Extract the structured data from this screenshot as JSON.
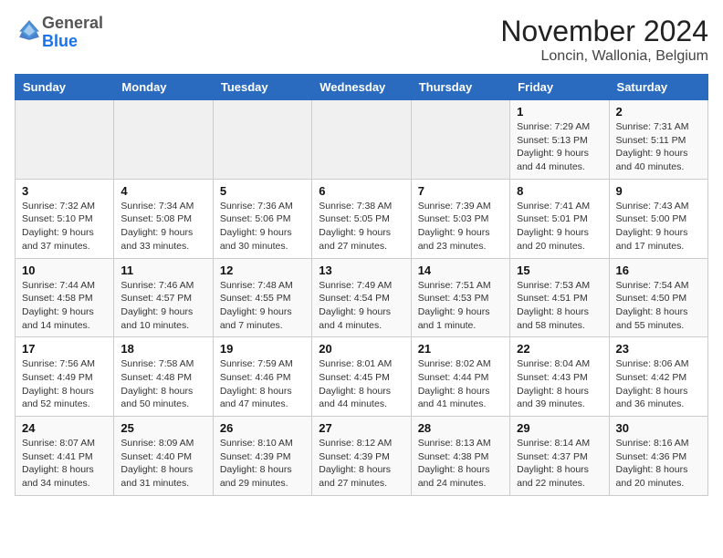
{
  "logo": {
    "general": "General",
    "blue": "Blue"
  },
  "header": {
    "month": "November 2024",
    "location": "Loncin, Wallonia, Belgium"
  },
  "days_of_week": [
    "Sunday",
    "Monday",
    "Tuesday",
    "Wednesday",
    "Thursday",
    "Friday",
    "Saturday"
  ],
  "weeks": [
    [
      {
        "day": "",
        "sunrise": "",
        "sunset": "",
        "daylight": ""
      },
      {
        "day": "",
        "sunrise": "",
        "sunset": "",
        "daylight": ""
      },
      {
        "day": "",
        "sunrise": "",
        "sunset": "",
        "daylight": ""
      },
      {
        "day": "",
        "sunrise": "",
        "sunset": "",
        "daylight": ""
      },
      {
        "day": "",
        "sunrise": "",
        "sunset": "",
        "daylight": ""
      },
      {
        "day": "1",
        "sunrise": "Sunrise: 7:29 AM",
        "sunset": "Sunset: 5:13 PM",
        "daylight": "Daylight: 9 hours and 44 minutes."
      },
      {
        "day": "2",
        "sunrise": "Sunrise: 7:31 AM",
        "sunset": "Sunset: 5:11 PM",
        "daylight": "Daylight: 9 hours and 40 minutes."
      }
    ],
    [
      {
        "day": "3",
        "sunrise": "Sunrise: 7:32 AM",
        "sunset": "Sunset: 5:10 PM",
        "daylight": "Daylight: 9 hours and 37 minutes."
      },
      {
        "day": "4",
        "sunrise": "Sunrise: 7:34 AM",
        "sunset": "Sunset: 5:08 PM",
        "daylight": "Daylight: 9 hours and 33 minutes."
      },
      {
        "day": "5",
        "sunrise": "Sunrise: 7:36 AM",
        "sunset": "Sunset: 5:06 PM",
        "daylight": "Daylight: 9 hours and 30 minutes."
      },
      {
        "day": "6",
        "sunrise": "Sunrise: 7:38 AM",
        "sunset": "Sunset: 5:05 PM",
        "daylight": "Daylight: 9 hours and 27 minutes."
      },
      {
        "day": "7",
        "sunrise": "Sunrise: 7:39 AM",
        "sunset": "Sunset: 5:03 PM",
        "daylight": "Daylight: 9 hours and 23 minutes."
      },
      {
        "day": "8",
        "sunrise": "Sunrise: 7:41 AM",
        "sunset": "Sunset: 5:01 PM",
        "daylight": "Daylight: 9 hours and 20 minutes."
      },
      {
        "day": "9",
        "sunrise": "Sunrise: 7:43 AM",
        "sunset": "Sunset: 5:00 PM",
        "daylight": "Daylight: 9 hours and 17 minutes."
      }
    ],
    [
      {
        "day": "10",
        "sunrise": "Sunrise: 7:44 AM",
        "sunset": "Sunset: 4:58 PM",
        "daylight": "Daylight: 9 hours and 14 minutes."
      },
      {
        "day": "11",
        "sunrise": "Sunrise: 7:46 AM",
        "sunset": "Sunset: 4:57 PM",
        "daylight": "Daylight: 9 hours and 10 minutes."
      },
      {
        "day": "12",
        "sunrise": "Sunrise: 7:48 AM",
        "sunset": "Sunset: 4:55 PM",
        "daylight": "Daylight: 9 hours and 7 minutes."
      },
      {
        "day": "13",
        "sunrise": "Sunrise: 7:49 AM",
        "sunset": "Sunset: 4:54 PM",
        "daylight": "Daylight: 9 hours and 4 minutes."
      },
      {
        "day": "14",
        "sunrise": "Sunrise: 7:51 AM",
        "sunset": "Sunset: 4:53 PM",
        "daylight": "Daylight: 9 hours and 1 minute."
      },
      {
        "day": "15",
        "sunrise": "Sunrise: 7:53 AM",
        "sunset": "Sunset: 4:51 PM",
        "daylight": "Daylight: 8 hours and 58 minutes."
      },
      {
        "day": "16",
        "sunrise": "Sunrise: 7:54 AM",
        "sunset": "Sunset: 4:50 PM",
        "daylight": "Daylight: 8 hours and 55 minutes."
      }
    ],
    [
      {
        "day": "17",
        "sunrise": "Sunrise: 7:56 AM",
        "sunset": "Sunset: 4:49 PM",
        "daylight": "Daylight: 8 hours and 52 minutes."
      },
      {
        "day": "18",
        "sunrise": "Sunrise: 7:58 AM",
        "sunset": "Sunset: 4:48 PM",
        "daylight": "Daylight: 8 hours and 50 minutes."
      },
      {
        "day": "19",
        "sunrise": "Sunrise: 7:59 AM",
        "sunset": "Sunset: 4:46 PM",
        "daylight": "Daylight: 8 hours and 47 minutes."
      },
      {
        "day": "20",
        "sunrise": "Sunrise: 8:01 AM",
        "sunset": "Sunset: 4:45 PM",
        "daylight": "Daylight: 8 hours and 44 minutes."
      },
      {
        "day": "21",
        "sunrise": "Sunrise: 8:02 AM",
        "sunset": "Sunset: 4:44 PM",
        "daylight": "Daylight: 8 hours and 41 minutes."
      },
      {
        "day": "22",
        "sunrise": "Sunrise: 8:04 AM",
        "sunset": "Sunset: 4:43 PM",
        "daylight": "Daylight: 8 hours and 39 minutes."
      },
      {
        "day": "23",
        "sunrise": "Sunrise: 8:06 AM",
        "sunset": "Sunset: 4:42 PM",
        "daylight": "Daylight: 8 hours and 36 minutes."
      }
    ],
    [
      {
        "day": "24",
        "sunrise": "Sunrise: 8:07 AM",
        "sunset": "Sunset: 4:41 PM",
        "daylight": "Daylight: 8 hours and 34 minutes."
      },
      {
        "day": "25",
        "sunrise": "Sunrise: 8:09 AM",
        "sunset": "Sunset: 4:40 PM",
        "daylight": "Daylight: 8 hours and 31 minutes."
      },
      {
        "day": "26",
        "sunrise": "Sunrise: 8:10 AM",
        "sunset": "Sunset: 4:39 PM",
        "daylight": "Daylight: 8 hours and 29 minutes."
      },
      {
        "day": "27",
        "sunrise": "Sunrise: 8:12 AM",
        "sunset": "Sunset: 4:39 PM",
        "daylight": "Daylight: 8 hours and 27 minutes."
      },
      {
        "day": "28",
        "sunrise": "Sunrise: 8:13 AM",
        "sunset": "Sunset: 4:38 PM",
        "daylight": "Daylight: 8 hours and 24 minutes."
      },
      {
        "day": "29",
        "sunrise": "Sunrise: 8:14 AM",
        "sunset": "Sunset: 4:37 PM",
        "daylight": "Daylight: 8 hours and 22 minutes."
      },
      {
        "day": "30",
        "sunrise": "Sunrise: 8:16 AM",
        "sunset": "Sunset: 4:36 PM",
        "daylight": "Daylight: 8 hours and 20 minutes."
      }
    ]
  ]
}
